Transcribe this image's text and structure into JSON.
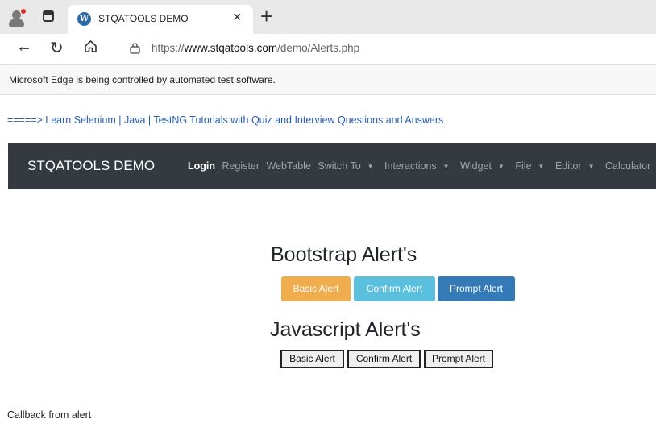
{
  "browser": {
    "tab_title": "STQATOOLS DEMO",
    "tab_close": "×",
    "new_tab": "+",
    "url_prefix": "https://",
    "url_host": "www.stqatools.com",
    "url_path": "/demo/Alerts.php",
    "infobar_text": "Microsoft Edge is being controlled by automated test software."
  },
  "page": {
    "top_link": "=====> Learn Selenium | Java | TestNG Tutorials with Quiz and Interview Questions and Answers",
    "brand": "STQATOOLS DEMO",
    "menu": {
      "login": "Login",
      "register": "Register",
      "webtable": "WebTable",
      "switch_to": "Switch To",
      "interactions": "Interactions",
      "widget": "Widget",
      "file": "File",
      "editor": "Editor",
      "calculator": "Calculator"
    },
    "bootstrap_heading": "Bootstrap Alert's",
    "bootstrap_buttons": {
      "basic": "Basic Alert",
      "confirm": "Confirm Alert",
      "prompt": "Prompt Alert"
    },
    "js_heading": "Javascript Alert's",
    "js_buttons": {
      "basic": "Basic Alert",
      "confirm": "Confirm Alert",
      "prompt": "Prompt Alert"
    },
    "callback_text": "Callback from alert"
  },
  "colors": {
    "navbar": "#343a40",
    "warning": "#f0ad4e",
    "info": "#5bc0de",
    "primary": "#337ab7",
    "link": "#2a5db0"
  },
  "icons": [
    "profile-icon",
    "tab-actions-icon",
    "wordpress-icon",
    "back-icon",
    "reload-icon",
    "home-icon",
    "lock-icon",
    "caret-down-icon"
  ]
}
